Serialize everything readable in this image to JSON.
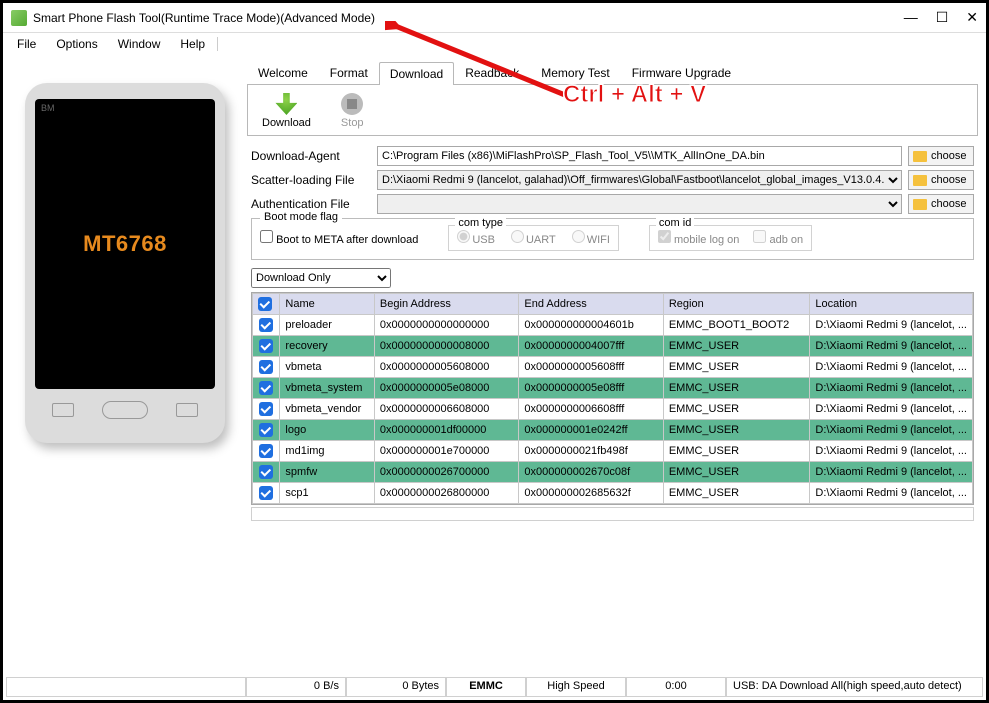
{
  "window": {
    "title": "Smart Phone Flash Tool(Runtime Trace Mode)(Advanced Mode)"
  },
  "menu": {
    "file": "File",
    "options": "Options",
    "window": "Window",
    "help": "Help"
  },
  "tabs": {
    "welcome": "Welcome",
    "format": "Format",
    "download": "Download",
    "readback": "Readback",
    "memory": "Memory Test",
    "firmware": "Firmware Upgrade"
  },
  "toolbar": {
    "download": "Download",
    "stop": "Stop"
  },
  "fields": {
    "da_label": "Download-Agent",
    "da_value": "C:\\Program Files (x86)\\MiFlashPro\\SP_Flash_Tool_V5\\\\MTK_AllInOne_DA.bin",
    "scatter_label": "Scatter-loading File",
    "scatter_value": "D:\\Xiaomi Redmi 9 (lancelot, galahad)\\Off_firmwares\\Global\\Fastboot\\lancelot_global_images_V13.0.4.",
    "auth_label": "Authentication File",
    "auth_value": "",
    "choose": "choose"
  },
  "bootflag": {
    "legend": "Boot mode flag",
    "meta": "Boot to META after download",
    "comtype_legend": "com type",
    "usb": "USB",
    "uart": "UART",
    "wifi": "WIFI",
    "comid_legend": "com id",
    "mobile": "mobile log on",
    "adb": "adb on"
  },
  "mode": "Download Only",
  "columns": {
    "name": "Name",
    "begin": "Begin Address",
    "end": "End Address",
    "region": "Region",
    "location": "Location"
  },
  "rows": [
    {
      "name": "preloader",
      "begin": "0x0000000000000000",
      "end": "0x000000000004601b",
      "region": "EMMC_BOOT1_BOOT2",
      "loc": "D:\\Xiaomi Redmi 9 (lancelot, ...",
      "green": false
    },
    {
      "name": "recovery",
      "begin": "0x0000000000008000",
      "end": "0x0000000004007fff",
      "region": "EMMC_USER",
      "loc": "D:\\Xiaomi Redmi 9 (lancelot, ...",
      "green": true
    },
    {
      "name": "vbmeta",
      "begin": "0x0000000005608000",
      "end": "0x0000000005608fff",
      "region": "EMMC_USER",
      "loc": "D:\\Xiaomi Redmi 9 (lancelot, ...",
      "green": false
    },
    {
      "name": "vbmeta_system",
      "begin": "0x0000000005e08000",
      "end": "0x0000000005e08fff",
      "region": "EMMC_USER",
      "loc": "D:\\Xiaomi Redmi 9 (lancelot, ...",
      "green": true
    },
    {
      "name": "vbmeta_vendor",
      "begin": "0x0000000006608000",
      "end": "0x0000000006608fff",
      "region": "EMMC_USER",
      "loc": "D:\\Xiaomi Redmi 9 (lancelot, ...",
      "green": false
    },
    {
      "name": "logo",
      "begin": "0x000000001df00000",
      "end": "0x000000001e0242ff",
      "region": "EMMC_USER",
      "loc": "D:\\Xiaomi Redmi 9 (lancelot, ...",
      "green": true
    },
    {
      "name": "md1img",
      "begin": "0x000000001e700000",
      "end": "0x0000000021fb498f",
      "region": "EMMC_USER",
      "loc": "D:\\Xiaomi Redmi 9 (lancelot, ...",
      "green": false
    },
    {
      "name": "spmfw",
      "begin": "0x0000000026700000",
      "end": "0x000000002670c08f",
      "region": "EMMC_USER",
      "loc": "D:\\Xiaomi Redmi 9 (lancelot, ...",
      "green": true
    },
    {
      "name": "scp1",
      "begin": "0x0000000026800000",
      "end": "0x000000002685632f",
      "region": "EMMC_USER",
      "loc": "D:\\Xiaomi Redmi 9 (lancelot, ...",
      "green": false
    }
  ],
  "status": {
    "speed": "0 B/s",
    "bytes": "0 Bytes",
    "storage": "EMMC",
    "mode": "High Speed",
    "time": "0:00",
    "usb": "USB: DA Download All(high speed,auto detect)"
  },
  "phone": {
    "chip": "MT6768",
    "bm": "BM"
  },
  "annotation": "Ctrl + Alt + V"
}
